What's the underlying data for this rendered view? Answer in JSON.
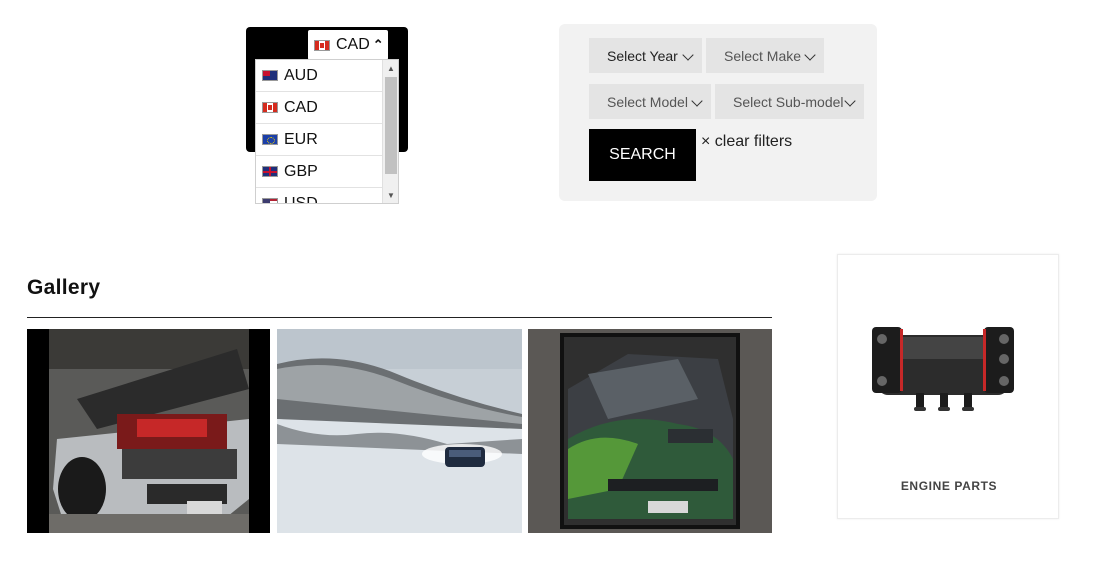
{
  "currency": {
    "current": {
      "code": "CAD",
      "flag": "flag-ca-icon"
    },
    "options": [
      {
        "code": "AUD",
        "flag": "flag-au-icon"
      },
      {
        "code": "CAD",
        "flag": "flag-ca-icon"
      },
      {
        "code": "EUR",
        "flag": "flag-eu-icon"
      },
      {
        "code": "GBP",
        "flag": "flag-gb-icon"
      },
      {
        "code": "USD",
        "flag": "flag-us-icon"
      }
    ]
  },
  "filters": {
    "year": "Select Year",
    "make": "Select Make",
    "model": "Select Model",
    "submodel": "Select Sub-model",
    "search_label": "SEARCH",
    "clear_label": "× clear filters"
  },
  "gallery": {
    "title": "Gallery"
  },
  "product_card": {
    "label": "ENGINE PARTS"
  },
  "colors": {
    "accent_black": "#000000",
    "panel_bg": "#f2f2f2",
    "select_bg": "#e4e4e4"
  }
}
